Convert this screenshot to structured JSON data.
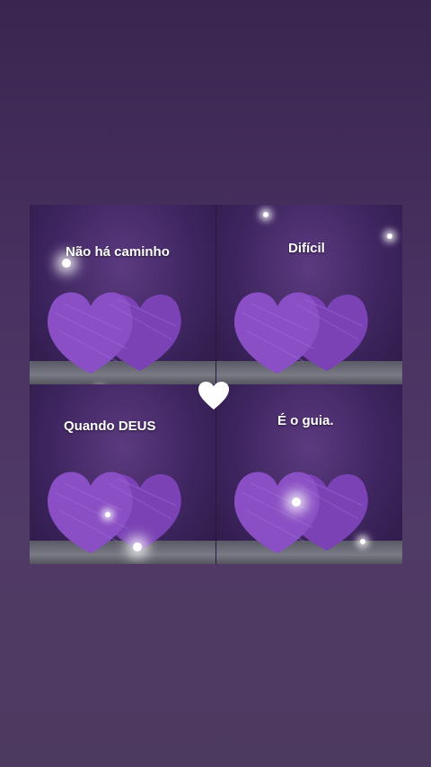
{
  "captions": {
    "top_left": "Não há caminho",
    "top_right": "Difícil",
    "bottom_left": "Quando DEUS",
    "bottom_right": "É o guia."
  },
  "icons": {
    "center": "heart-icon"
  },
  "colors": {
    "heart": "#8a4fc4",
    "background": "#3a2550"
  }
}
